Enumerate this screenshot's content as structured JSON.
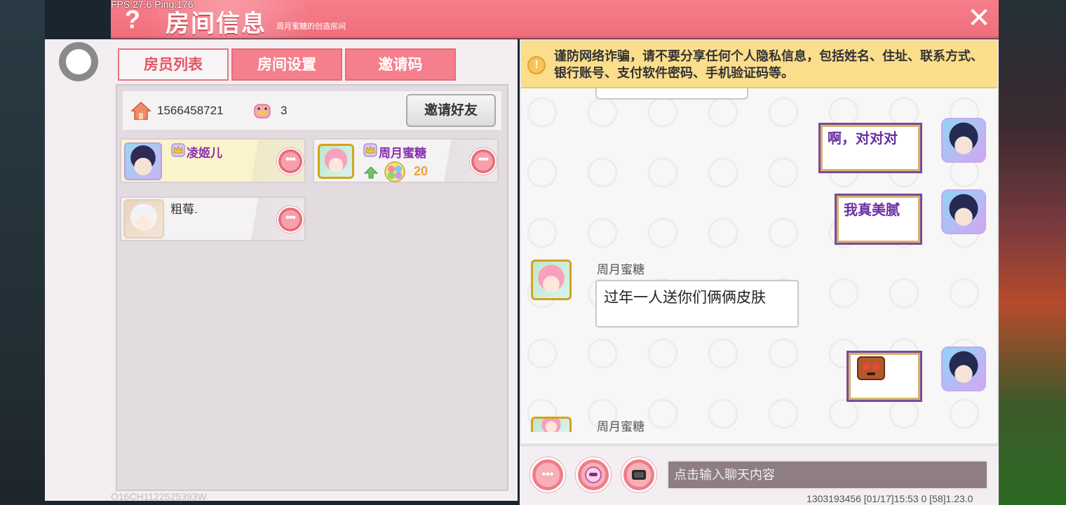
{
  "overlay": {
    "fps": "FPS:27.6  Ping:176"
  },
  "header": {
    "title": "房间信息",
    "subtitle": "周月蜜糖的创造房间",
    "help_icon": "question-icon",
    "close_icon": "close-icon",
    "accent": "#f77e8b"
  },
  "tabs": [
    {
      "label": "房员列表",
      "active": true
    },
    {
      "label": "房间设置",
      "active": false
    },
    {
      "label": "邀请码",
      "active": false
    }
  ],
  "room": {
    "id": "1566458721",
    "player_count": "3",
    "invite_label": "邀请好友"
  },
  "members": [
    {
      "name": "凌姬儿",
      "host_badge": true,
      "highlight": true
    },
    {
      "name": "周月蜜糖",
      "host_badge": true,
      "level": "20"
    },
    {
      "name": "粗莓."
    }
  ],
  "footer_uid": "O16CH1122525393W",
  "chat": {
    "warning": "谨防网络诈骗，请不要分享任何个人隐私信息，包括姓名、住址、联系方式、银行账号、支付软件密码、手机验证码等。",
    "messages": [
      {
        "from": "self",
        "text": "啊，对对对"
      },
      {
        "from": "self",
        "text": "我真美腻"
      },
      {
        "from": "other",
        "sender": "周月蜜糖",
        "text": "过年一人送你们俩俩皮肤"
      },
      {
        "from": "self",
        "emoji": "angry-face-emoji"
      },
      {
        "from": "other",
        "sender": "周月蜜糖"
      }
    ],
    "input_placeholder": "点击输入聊天内容"
  },
  "status_bar": "1303193456    [01/17]15:53 0    [58]1.23.0"
}
